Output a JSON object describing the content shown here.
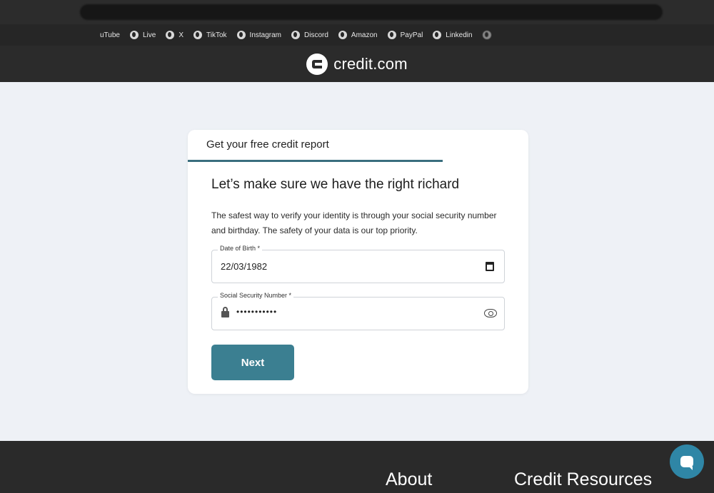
{
  "bookmarks": [
    {
      "label": "uTube",
      "faded": false
    },
    {
      "label": "Live",
      "faded": false
    },
    {
      "label": "X",
      "faded": false
    },
    {
      "label": "TikTok",
      "faded": false
    },
    {
      "label": "Instagram",
      "faded": false
    },
    {
      "label": "Discord",
      "faded": false
    },
    {
      "label": "Amazon",
      "faded": false
    },
    {
      "label": "PayPal",
      "faded": false
    },
    {
      "label": "Linkedin",
      "faded": false
    }
  ],
  "header": {
    "logo_text": "credit.com"
  },
  "card": {
    "tab_label": "Get your free credit report",
    "title": "Let’s make sure we have the right richard",
    "description": "The safest way to verify your identity is through your social security number and birthday. The safety of your data is our top priority.",
    "dob": {
      "label": "Date of Birth *",
      "value": "22/03/1982"
    },
    "ssn": {
      "label": "Social Security Number *",
      "value": "•••••••••••"
    },
    "next_label": "Next"
  },
  "footer": {
    "about": "About",
    "credit_resources": "Credit Resources"
  },
  "colors": {
    "accent": "#3b7f91",
    "header_bg": "#2b2b2b",
    "page_bg": "#eef1f6"
  }
}
